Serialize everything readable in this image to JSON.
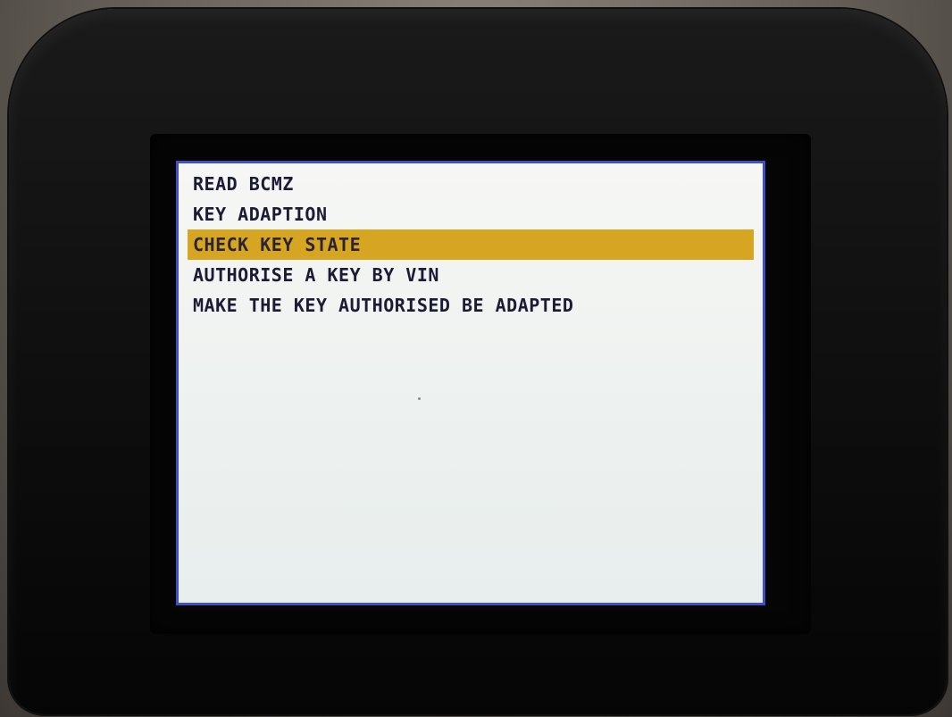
{
  "device": {
    "screen": {
      "menu": {
        "items": [
          {
            "label": "READ BCMZ"
          },
          {
            "label": "KEY ADAPTION"
          },
          {
            "label": "CHECK KEY STATE"
          },
          {
            "label": "AUTHORISE A KEY BY VIN"
          },
          {
            "label": "MAKE THE KEY AUTHORISED BE ADAPTED"
          }
        ],
        "selected_label": "CHECK KEY STATE"
      }
    }
  },
  "colors": {
    "screen_background": "#f2f4f1",
    "screen_border": "#3f4fc4",
    "highlight": "#d6a521",
    "text": "#1b1b35",
    "device_body": "#0e0e0e"
  }
}
